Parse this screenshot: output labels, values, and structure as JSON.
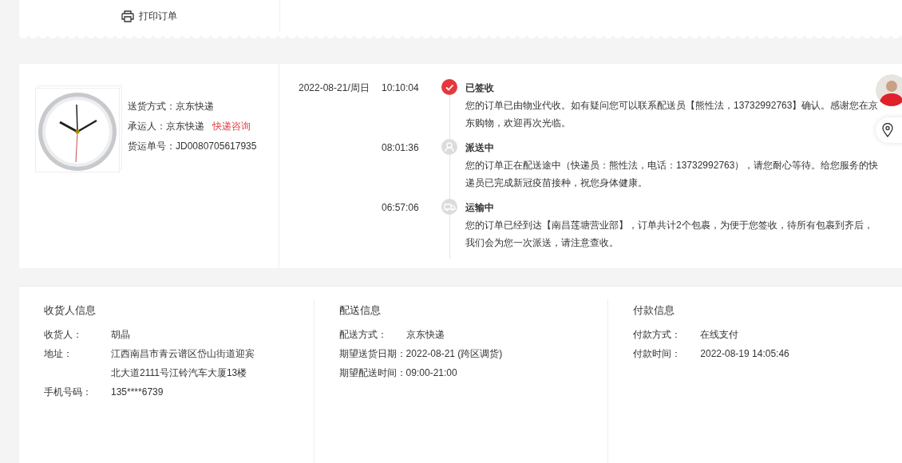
{
  "print_button": {
    "label": "打印订单"
  },
  "shipment": {
    "fields": [
      {
        "label": "送货方式：",
        "value": "京东快递"
      },
      {
        "label": "承运人：",
        "value": "京东快递",
        "link": "快递咨询"
      },
      {
        "label": "货运单号：",
        "value": "JD0080705617935"
      }
    ]
  },
  "tracking": [
    {
      "date": "2022-08-21/周日",
      "time": "10:10:04",
      "status": "已签收",
      "kind": "signed",
      "active": true,
      "detail": "您的订单已由物业代收。如有疑问您可以联系配送员【熊性法，13732992763】确认。感谢您在京东购物，欢迎再次光临。"
    },
    {
      "time": "08:01:36",
      "status": "派送中",
      "kind": "delivering",
      "active": false,
      "detail": "您的订单正在配送途中（快递员：熊性法，电话：13732992763），请您耐心等待。给您服务的快递员已完成新冠疫苗接种，祝您身体健康。"
    },
    {
      "time": "06:57:06",
      "status": "运输中",
      "kind": "transit",
      "active": false,
      "detail": "您的订单已经到达【南昌莲塘营业部】，订单共计2个包裹，为便于您签收，待所有包裹到齐后，我们会为您一次派送，请注意查收。"
    }
  ],
  "info_sections": [
    {
      "title": "收货人信息",
      "rows": [
        {
          "label": "收货人：",
          "value": "胡晶"
        },
        {
          "label": "地址：",
          "value": "江西南昌市青云谱区岱山街道迎宾北大道2111号江铃汽车大厦13楼"
        },
        {
          "label": "手机号码：",
          "value": "135****6739"
        }
      ]
    },
    {
      "title": "配送信息",
      "rows": [
        {
          "label": "配送方式：",
          "value": "京东快递"
        },
        {
          "label": "期望送货日期：",
          "value": "2022-08-21 (跨区调货)"
        },
        {
          "label": "期望配送时间：",
          "value": "09:00-21:00"
        }
      ]
    },
    {
      "title": "付款信息",
      "rows": [
        {
          "label": "付款方式：",
          "value": "在线支付"
        },
        {
          "label": "付款时间：",
          "value": "2022-08-19 14:05:46"
        }
      ]
    }
  ]
}
